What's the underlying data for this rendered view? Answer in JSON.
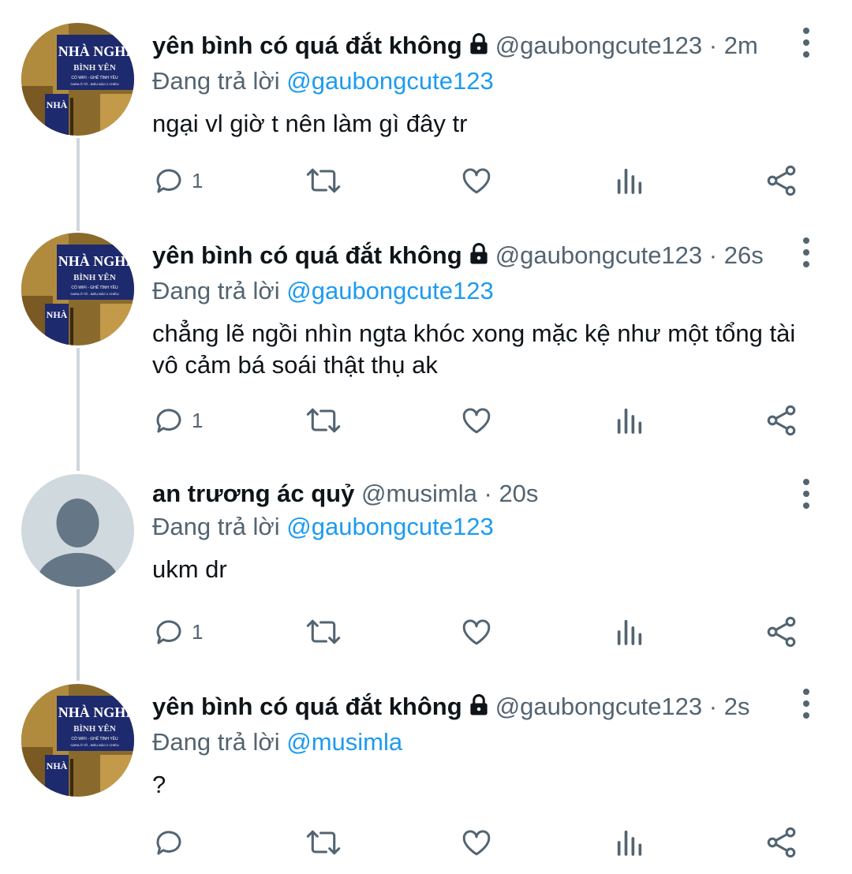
{
  "colors": {
    "accent": "#1d9bf0",
    "secondary_text": "#536471",
    "primary_text": "#0f1419",
    "thread_line": "#d0d6dc"
  },
  "tweets": [
    {
      "name": "yên bình có quá đắt không",
      "locked": true,
      "handle": "@gaubongcute123",
      "separator": "·",
      "time": "2m",
      "replying_prefix": "Đang trả lời",
      "replying_to": "@gaubongcute123",
      "text": "ngại vl giờ t nên làm gì đây tr",
      "reply_count": "1",
      "avatar": "photo-sign-avatar",
      "avatar_sign_text": [
        "NHÀ NGHI",
        "BÌNH YÊN",
        "CÓ WIFI - GHẾ TÌNH YÊU",
        "GARA Ô TÔ - BIỂU BẢO 2 CHIỀU",
        "NHÀ"
      ]
    },
    {
      "name": "yên bình có quá đắt không",
      "locked": true,
      "handle": "@gaubongcute123",
      "separator": "·",
      "time": "26s",
      "replying_prefix": "Đang trả lời",
      "replying_to": "@gaubongcute123",
      "text": "chẳng lẽ ngồi nhìn ngta khóc xong mặc kệ như một tổng tài vô cảm bá soái thật thụ ak",
      "reply_count": "1",
      "avatar": "photo-sign-avatar",
      "avatar_sign_text": [
        "NHÀ NGHI",
        "BÌNH YÊN",
        "CÓ WIFI - GHẾ TÌNH YÊU",
        "GARA Ô TÔ - BIỂU BẢO 2 CHIỀU",
        "NHÀ"
      ]
    },
    {
      "name": "an trương ác quỷ",
      "locked": false,
      "handle": "@musimla",
      "separator": "·",
      "time": "20s",
      "replying_prefix": "Đang trả lời",
      "replying_to": "@gaubongcute123",
      "text": "ukm dr",
      "reply_count": "1",
      "avatar": "default-person-avatar"
    },
    {
      "name": "yên bình có quá đắt không",
      "locked": true,
      "handle": "@gaubongcute123",
      "separator": "·",
      "time": "2s",
      "replying_prefix": "Đang trả lời",
      "replying_to": "@musimla",
      "text": "?",
      "reply_count": "",
      "avatar": "photo-sign-avatar",
      "avatar_sign_text": [
        "NHÀ NGHI",
        "BÌNH YÊN",
        "CÓ WIFI - GHẾ TÌNH YÊU",
        "GARA Ô TÔ - BIỂU BẢO 2 CHIỀU",
        "NHÀ"
      ]
    }
  ],
  "action_icons": [
    "reply-icon",
    "retweet-icon",
    "like-icon",
    "views-icon",
    "share-icon"
  ]
}
